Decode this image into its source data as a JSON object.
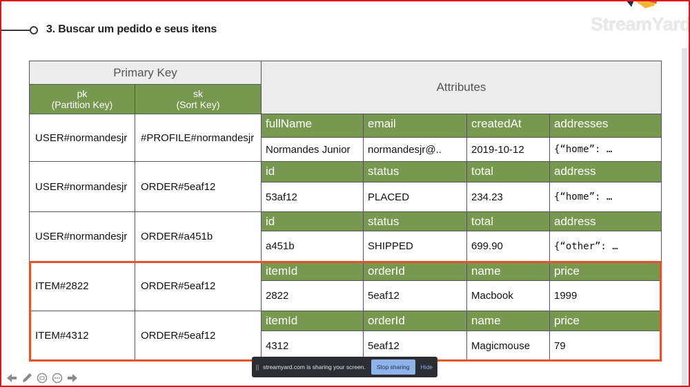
{
  "slide": {
    "title": "3. Buscar um pedido e seus itens",
    "logo": "StreamYard"
  },
  "table": {
    "primary_key_label": "Primary Key",
    "pk_label": "pk\n(Partition Key)",
    "sk_label": "sk\n(Sort Key)",
    "attributes_label": "Attributes",
    "rows": [
      {
        "pk": "USER#normandesjr",
        "sk": "#PROFILE#normandesjr",
        "headers": [
          "fullName",
          "email",
          "createdAt",
          "addresses"
        ],
        "values": [
          "Normandes Junior",
          "normandesjr@..",
          "2019-10-12",
          "{“home”: …"
        ]
      },
      {
        "pk": "USER#normandesjr",
        "sk": "ORDER#5eaf12",
        "headers": [
          "id",
          "status",
          "total",
          "address"
        ],
        "values": [
          "53af12",
          "PLACED",
          "234.23",
          "{“home”: …"
        ]
      },
      {
        "pk": "USER#normandesjr",
        "sk": "ORDER#a451b",
        "headers": [
          "id",
          "status",
          "total",
          "address"
        ],
        "values": [
          "a451b",
          "SHIPPED",
          "699.90",
          "{“other”: …"
        ]
      },
      {
        "pk": "ITEM#2822",
        "sk": "ORDER#5eaf12",
        "headers": [
          "itemId",
          "orderId",
          "name",
          "price"
        ],
        "values": [
          "2822",
          "5eaf12",
          "Macbook",
          "1999"
        ]
      },
      {
        "pk": "ITEM#4312",
        "sk": "ORDER#5eaf12",
        "headers": [
          "itemId",
          "orderId",
          "name",
          "price"
        ],
        "values": [
          "4312",
          "5eaf12",
          "Magicmouse",
          "79"
        ]
      }
    ]
  },
  "share_bar": {
    "grip": "||",
    "message": "streamyard.com is sharing your screen.",
    "stop_label": "Stop sharing",
    "hide_label": "Hide"
  },
  "toolbar_icons": [
    "arrow-left-icon",
    "pen-icon",
    "grid-icon",
    "more-icon",
    "arrow-right-icon"
  ],
  "colors": {
    "header_green": "#77984f",
    "header_gray": "#ececec",
    "highlight": "#e2532e",
    "frame": "#e01616"
  }
}
